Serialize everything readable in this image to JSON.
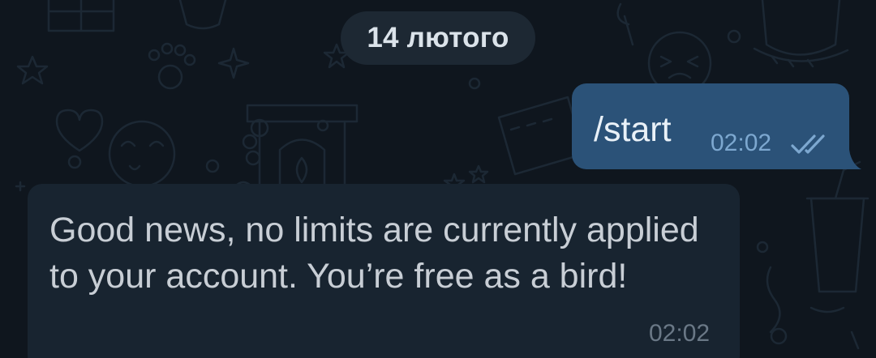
{
  "chat": {
    "date_separator": "14 лютого",
    "messages": [
      {
        "direction": "outgoing",
        "text": "/start",
        "time": "02:02",
        "status_icon": "double-check-icon"
      },
      {
        "direction": "incoming",
        "text": "Good news, no limits are currently applied to your account. You’re free as a bird!",
        "time": "02:02"
      }
    ]
  },
  "colors": {
    "background": "#0f161e",
    "outgoing_bubble": "#2b5278",
    "incoming_bubble": "#182430",
    "date_pill": "#1d2833",
    "read_ticks": "#7da8d0"
  }
}
